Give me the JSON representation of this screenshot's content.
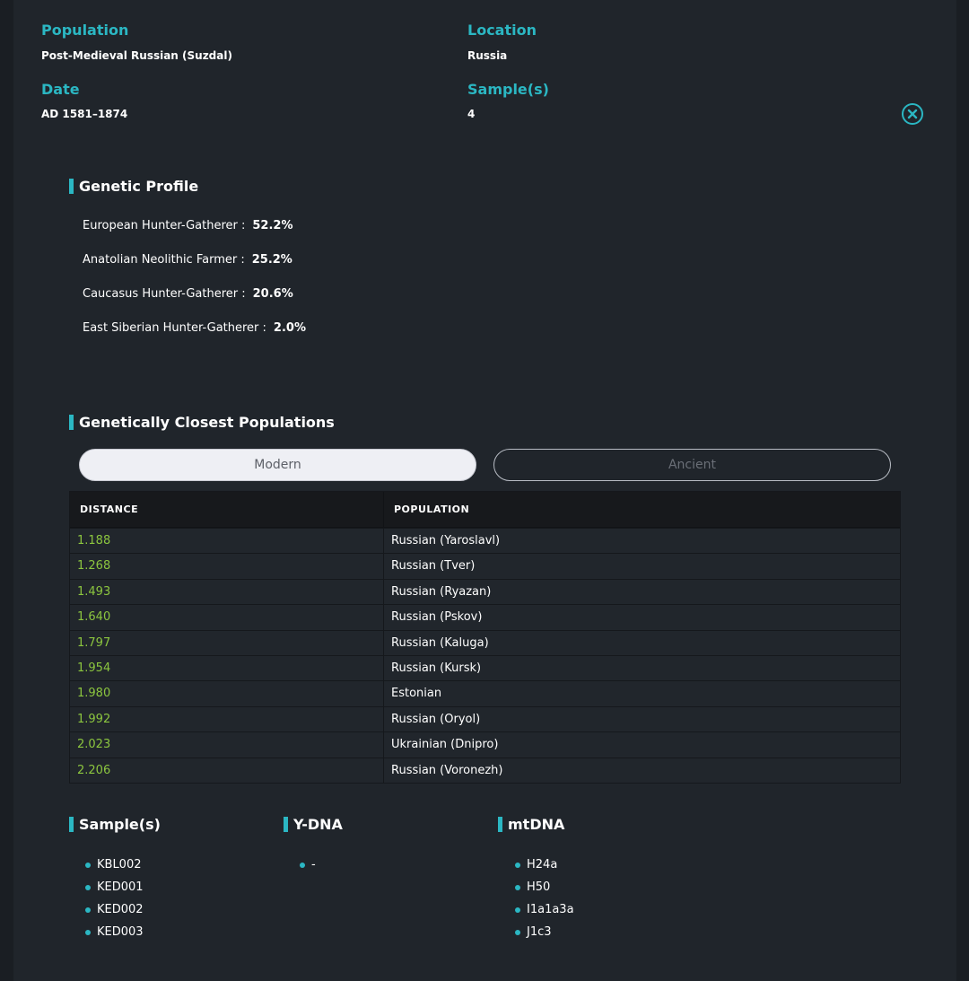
{
  "header": {
    "population_label": "Population",
    "population_value": "Post-Medieval Russian (Suzdal)",
    "location_label": "Location",
    "location_value": "Russia",
    "date_label": "Date",
    "date_value": "AD 1581–1874",
    "samples_label": "Sample(s)",
    "samples_value": "4",
    "close_icon": "close-circle-icon"
  },
  "genetic_profile": {
    "title": "Genetic Profile",
    "components": [
      {
        "name": "European Hunter-Gatherer :",
        "value": "52.2%"
      },
      {
        "name": "Anatolian Neolithic Farmer :",
        "value": "25.2%"
      },
      {
        "name": "Caucasus Hunter-Gatherer :",
        "value": "20.6%"
      },
      {
        "name": "East Siberian Hunter-Gatherer :",
        "value": "2.0%"
      }
    ]
  },
  "closest": {
    "title": "Genetically Closest Populations",
    "tabs": [
      {
        "label": "Modern",
        "active": true
      },
      {
        "label": "Ancient",
        "active": false
      }
    ],
    "columns": [
      "DISTANCE",
      "POPULATION"
    ],
    "rows": [
      {
        "distance": "1.188",
        "population": "Russian (Yaroslavl)"
      },
      {
        "distance": "1.268",
        "population": "Russian (Tver)"
      },
      {
        "distance": "1.493",
        "population": "Russian (Ryazan)"
      },
      {
        "distance": "1.640",
        "population": "Russian (Pskov)"
      },
      {
        "distance": "1.797",
        "population": "Russian (Kaluga)"
      },
      {
        "distance": "1.954",
        "population": "Russian (Kursk)"
      },
      {
        "distance": "1.980",
        "population": "Estonian"
      },
      {
        "distance": "1.992",
        "population": "Russian (Oryol)"
      },
      {
        "distance": "2.023",
        "population": "Ukrainian (Dnipro)"
      },
      {
        "distance": "2.206",
        "population": "Russian (Voronezh)"
      }
    ]
  },
  "samples": {
    "title": "Sample(s)",
    "items": [
      "KBL002",
      "KED001",
      "KED002",
      "KED003"
    ]
  },
  "ydna": {
    "title": "Y-DNA",
    "items": [
      "-"
    ]
  },
  "mtdna": {
    "title": "mtDNA",
    "items": [
      "H24a",
      "H50",
      "I1a1a3a",
      "J1c3"
    ]
  },
  "colors": {
    "accent": "#2bb7c3",
    "distance": "#8cc63f",
    "panel": "#20252b"
  }
}
